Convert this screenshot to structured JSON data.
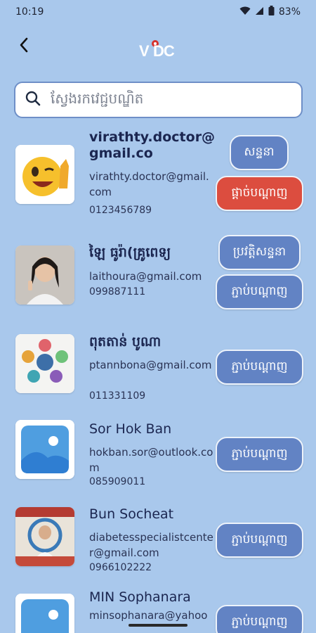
{
  "status_bar": {
    "time": "10:19",
    "battery": "83%"
  },
  "header": {
    "logo_text": "VDC"
  },
  "search": {
    "placeholder": "ស្វែងរកវេជ្ជបណ្ឌិត"
  },
  "doctors": [
    {
      "name": "virathty.doctor@gmail.co",
      "email": "virathty.doctor@gmail.com",
      "phone": "0123456789",
      "buttons": [
        "សន្ទនា",
        "ផ្ដាច់បណ្ដាញ"
      ]
    },
    {
      "name": "ឡៃ ធូរ៉ា(គ្រូពេទ្យ",
      "email": "laithoura@gmail.com",
      "phone": "099887111",
      "buttons": [
        "ប្រវត្តិសន្ទនា",
        "ភ្ជាប់បណ្ដាញ"
      ]
    },
    {
      "name": "ពុតតាន់ បូណា",
      "email": "ptannbona@gmail.com",
      "phone": "011331109",
      "buttons": [
        "ភ្ជាប់បណ្ដាញ"
      ]
    },
    {
      "name": "Sor Hok Ban",
      "email": "hokban.sor@outlook.com",
      "phone": "085909011",
      "buttons": [
        "ភ្ជាប់បណ្ដាញ"
      ]
    },
    {
      "name": "Bun Socheat",
      "email": "diabetesspecialistcenter@gmail.com",
      "phone": "0966102222",
      "buttons": [
        "ភ្ជាប់បណ្ដាញ"
      ]
    },
    {
      "name": "MIN Sophanara",
      "email": "minsophanara@yahoo",
      "phone": "",
      "buttons": [
        "ភ្ជាប់បណ្ដាញ"
      ]
    }
  ],
  "colors": {
    "background": "#a9c8ec",
    "primary_button": "#6283c4",
    "danger_button": "#dc4d3f"
  }
}
